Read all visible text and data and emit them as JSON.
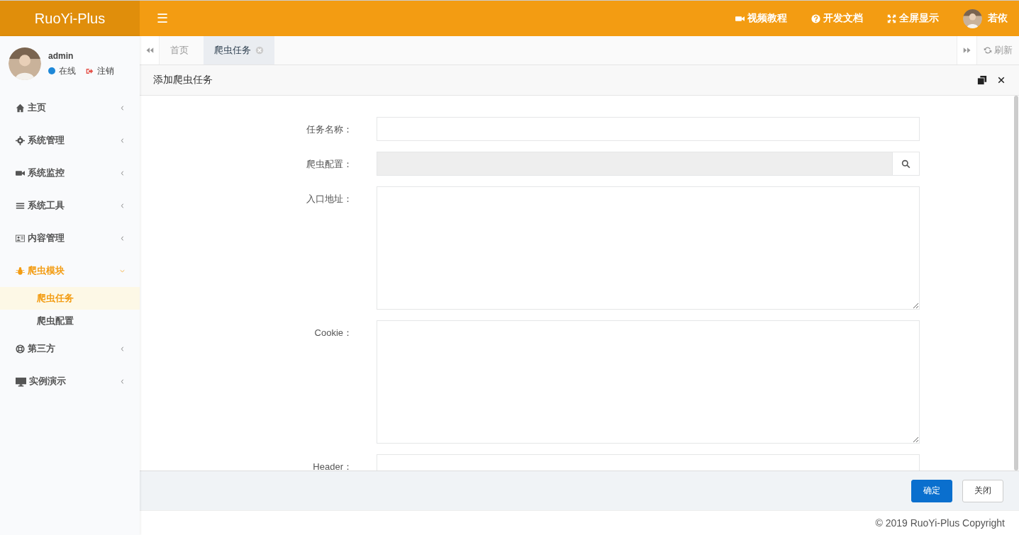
{
  "header": {
    "logo": "RuoYi-Plus",
    "menu_icon": "☰",
    "links": [
      {
        "label": "视频教程"
      },
      {
        "label": "开发文档"
      },
      {
        "label": "全屏显示"
      }
    ],
    "user": "若依"
  },
  "sidebar": {
    "user": {
      "name": "admin",
      "status": "在线",
      "logout": "注销"
    },
    "items": [
      {
        "label": "主页",
        "expanded": false,
        "selected": false
      },
      {
        "label": "系统管理",
        "expanded": false,
        "selected": false
      },
      {
        "label": "系统监控",
        "expanded": false,
        "selected": false
      },
      {
        "label": "系统工具",
        "expanded": false,
        "selected": false
      },
      {
        "label": "内容管理",
        "expanded": false,
        "selected": false
      },
      {
        "label": "爬虫模块",
        "expanded": true,
        "selected": true,
        "children": [
          {
            "label": "爬虫任务",
            "selected": true
          },
          {
            "label": "爬虫配置",
            "selected": false
          }
        ]
      },
      {
        "label": "第三方",
        "expanded": false,
        "selected": false
      },
      {
        "label": "实例演示",
        "expanded": false,
        "selected": false
      }
    ]
  },
  "tabs": [
    {
      "label": "首页",
      "selected": false,
      "closable": false
    },
    {
      "label": "爬虫任务",
      "selected": true,
      "closable": true
    }
  ],
  "refresh": "刷新",
  "dialog": {
    "title": "添加爬虫任务",
    "fields": [
      {
        "label": "任务名称：",
        "kind": "text"
      },
      {
        "label": "爬虫配置：",
        "kind": "lookup"
      },
      {
        "label": "入口地址：",
        "kind": "textarea"
      },
      {
        "label": "Cookie：",
        "kind": "textarea"
      },
      {
        "label": "Header：",
        "kind": "text"
      }
    ],
    "buttons": [
      {
        "label": "确定",
        "kind": "primary"
      },
      {
        "label": "关闭",
        "kind": "default"
      }
    ]
  },
  "footer": "© 2019 RuoYi-Plus Copyright"
}
